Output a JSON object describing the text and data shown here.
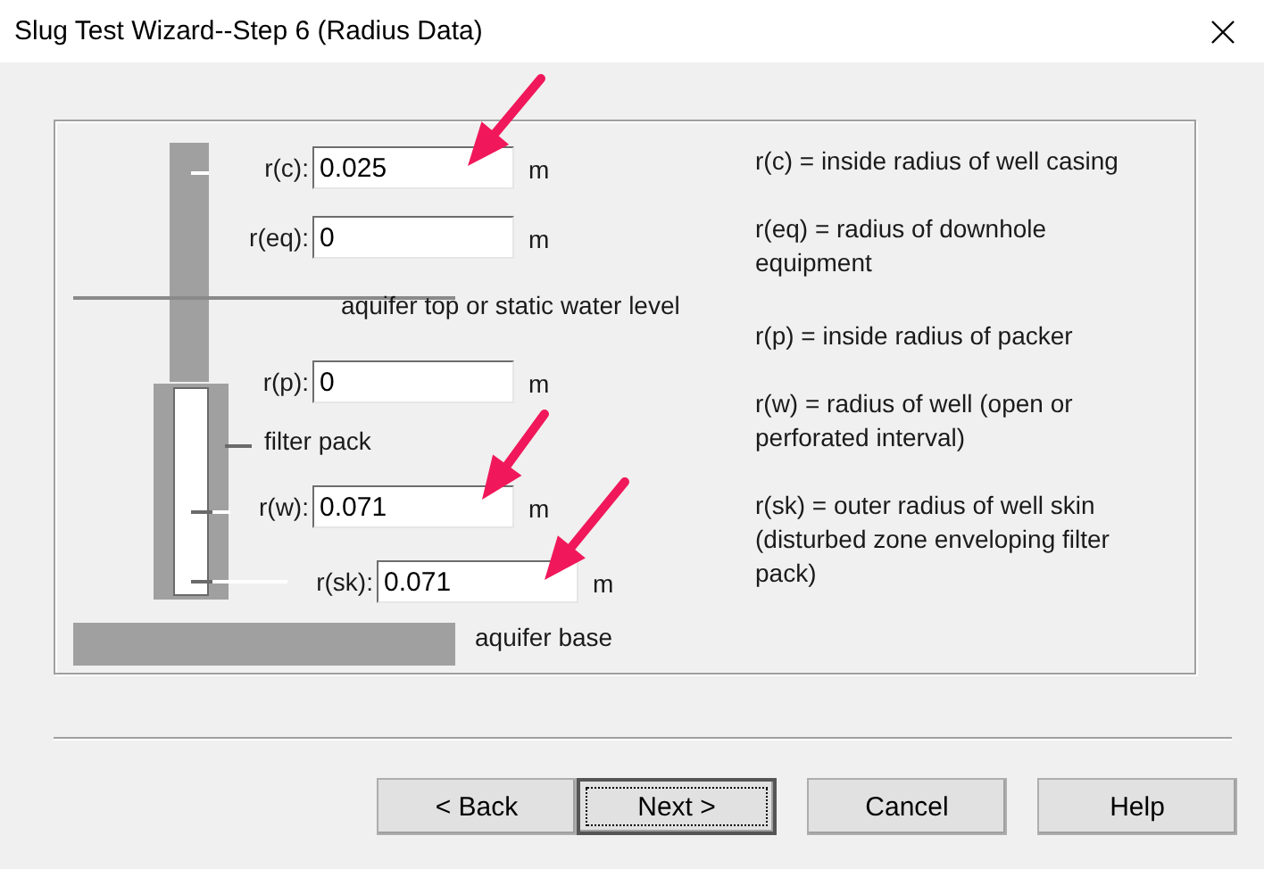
{
  "window": {
    "title": "Slug Test Wizard--Step 6 (Radius Data)"
  },
  "fields": [
    {
      "label": "r(c):",
      "value": "0.025",
      "unit": "m"
    },
    {
      "label": "r(eq):",
      "value": "0",
      "unit": "m"
    },
    {
      "label": "r(p):",
      "value": "0",
      "unit": "m"
    },
    {
      "label": "r(w):",
      "value": "0.071",
      "unit": "m"
    },
    {
      "label": "r(sk):",
      "value": "0.071",
      "unit": "m"
    }
  ],
  "diagram_labels": [
    "aquifer top or static water level",
    "filter pack",
    "aquifer base"
  ],
  "definitions": [
    "r(c) = inside radius of well casing",
    "r(eq) = radius of downhole equipment",
    "r(p) = inside radius of packer",
    "r(w) = radius of well (open or perforated interval)",
    "r(sk) = outer radius of well skin (disturbed zone enveloping filter pack)"
  ],
  "buttons": [
    {
      "label": "< Back",
      "default": false
    },
    {
      "label": "Next >",
      "default": true
    },
    {
      "label": "Cancel",
      "default": false
    },
    {
      "label": "Help",
      "default": false
    }
  ]
}
